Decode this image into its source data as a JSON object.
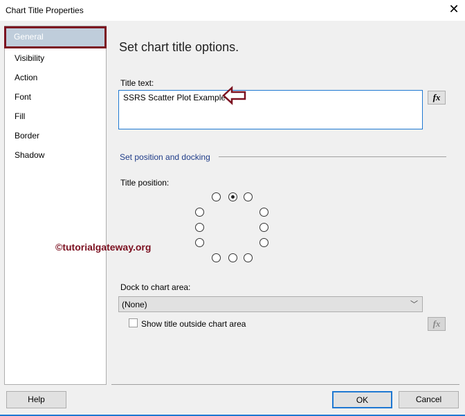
{
  "window": {
    "title": "Chart Title Properties"
  },
  "sidebar": {
    "items": [
      {
        "label": "General",
        "selected": true
      },
      {
        "label": "Visibility"
      },
      {
        "label": "Action"
      },
      {
        "label": "Font"
      },
      {
        "label": "Fill"
      },
      {
        "label": "Border"
      },
      {
        "label": "Shadow"
      }
    ]
  },
  "main": {
    "heading": "Set chart title options.",
    "title_text_label": "Title text:",
    "title_text_value": "SSRS Scatter Plot Example",
    "section_label": "Set position and docking",
    "title_position_label": "Title position:",
    "title_position_selected": "top-center",
    "dock_label": "Dock to chart area:",
    "dock_value": "(None)",
    "show_outside_label": "Show title outside chart area",
    "show_outside_checked": false,
    "fx_label": "fx"
  },
  "watermark": "©tutorialgateway.org",
  "buttons": {
    "help": "Help",
    "ok": "OK",
    "cancel": "Cancel"
  },
  "colors": {
    "accent": "#1e78d2",
    "highlight": "#7b1020"
  }
}
